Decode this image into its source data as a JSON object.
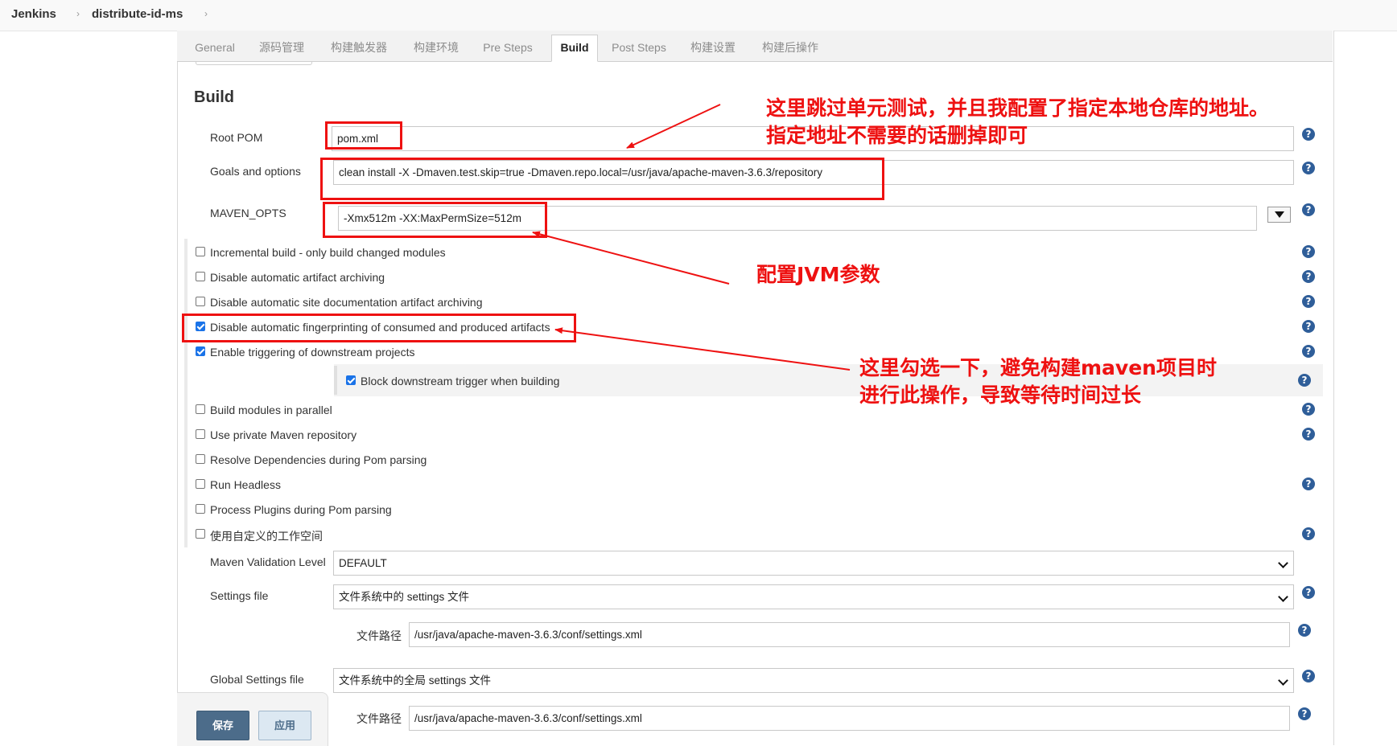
{
  "breadcrumb": {
    "items": [
      "Jenkins",
      "distribute-id-ms"
    ],
    "separator": "›"
  },
  "tabs": [
    {
      "label": "General",
      "active": false
    },
    {
      "label": "源码管理",
      "active": false
    },
    {
      "label": "构建触发器",
      "active": false
    },
    {
      "label": "构建环境",
      "active": false
    },
    {
      "label": "Pre Steps",
      "active": false
    },
    {
      "label": "Build",
      "active": true
    },
    {
      "label": "Post Steps",
      "active": false
    },
    {
      "label": "构建设置",
      "active": false
    },
    {
      "label": "构建后操作",
      "active": false
    }
  ],
  "section_title": "Build",
  "fields": {
    "root_pom": {
      "label": "Root POM",
      "value": "pom.xml"
    },
    "goals": {
      "label": "Goals and options",
      "value": "clean install  -X -Dmaven.test.skip=true  -Dmaven.repo.local=/usr/java/apache-maven-3.6.3/repository"
    },
    "maven_opts": {
      "label": "MAVEN_OPTS",
      "value": "-Xmx512m -XX:MaxPermSize=512m"
    }
  },
  "checkboxes": [
    {
      "label": "Incremental build - only build changed modules",
      "checked": false
    },
    {
      "label": "Disable automatic artifact archiving",
      "checked": false
    },
    {
      "label": "Disable automatic site documentation artifact archiving",
      "checked": false
    },
    {
      "label": "Disable automatic fingerprinting of consumed and produced artifacts",
      "checked": true
    },
    {
      "label": "Enable triggering of downstream projects",
      "checked": true
    },
    {
      "label": "Block downstream trigger when building",
      "checked": true
    },
    {
      "label": "Build modules in parallel",
      "checked": false
    },
    {
      "label": "Use private Maven repository",
      "checked": false
    },
    {
      "label": "Resolve Dependencies during Pom parsing",
      "checked": false
    },
    {
      "label": "Run Headless",
      "checked": false
    },
    {
      "label": "Process Plugins during Pom parsing",
      "checked": false
    },
    {
      "label": "使用自定义的工作空间",
      "checked": false
    }
  ],
  "maven_validation": {
    "label": "Maven Validation Level",
    "value": "DEFAULT"
  },
  "settings_file": {
    "label": "Settings file",
    "value": "文件系统中的 settings 文件",
    "path_label": "文件路径",
    "path_value": "/usr/java/apache-maven-3.6.3/conf/settings.xml"
  },
  "global_settings_file": {
    "label": "Global Settings file",
    "value": "文件系统中的全局 settings 文件",
    "path_label": "文件路径",
    "path_value": "/usr/java/apache-maven-3.6.3/conf/settings.xml"
  },
  "buttons": {
    "save": "保存",
    "apply": "应用"
  },
  "help_glyph": "?",
  "annotations": {
    "skip_tests_line1": "这里跳过单元测试，并且我配置了指定本地仓库的地址。",
    "skip_tests_line2": "指定地址不需要的话删掉即可",
    "jvm": "配置JVM参数",
    "fingerprint_line1": "这里勾选一下，避免构建maven项目时",
    "fingerprint_line2": "进行此操作，导致等待时间过长"
  },
  "colors": {
    "annotation_red": "#ee1111",
    "help_blue": "#2f5e99",
    "checkbox_blue": "#1a73e8",
    "save_button": "#4c6c8a"
  },
  "icons": [
    "help-icon",
    "checkbox-icon",
    "dropdown-arrow-icon",
    "chevron-down-icon",
    "annotation-arrow"
  ]
}
